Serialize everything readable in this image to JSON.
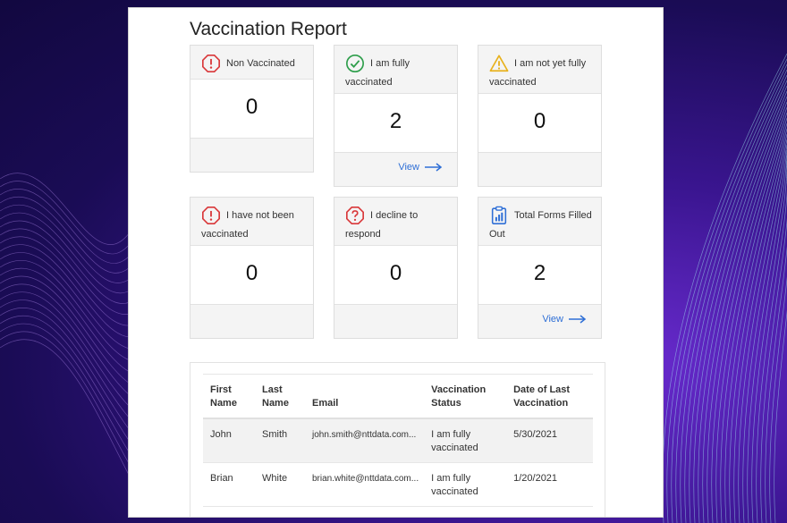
{
  "page": {
    "title": "Vaccination Report"
  },
  "cards": [
    {
      "label": "Non Vaccinated",
      "value": "0",
      "icon": "alert-octagon-icon",
      "link": ""
    },
    {
      "label": "I am fully vaccinated",
      "value": "2",
      "icon": "check-circle-icon",
      "link": "View"
    },
    {
      "label": "I am not yet fully vaccinated",
      "value": "0",
      "icon": "warning-triangle-icon",
      "link": ""
    },
    {
      "label": "I have not been vaccinated",
      "value": "0",
      "icon": "alert-octagon-icon",
      "link": ""
    },
    {
      "label": "I decline to respond",
      "value": "0",
      "icon": "question-octagon-icon",
      "link": ""
    },
    {
      "label": "Total Forms Filled Out",
      "value": "2",
      "icon": "clipboard-chart-icon",
      "link": "View"
    }
  ],
  "table": {
    "headers": [
      "First Name",
      "Last Name",
      "Email",
      "Vaccination Status",
      "Date of Last Vaccination"
    ],
    "rows": [
      [
        "John",
        "Smith",
        "john.smith@nttdata.com...",
        "I am fully vaccinated",
        "5/30/2021"
      ],
      [
        "Brian",
        "White",
        "brian.white@nttdata.com...",
        "I am fully vaccinated",
        "1/20/2021"
      ]
    ]
  },
  "colors": {
    "link": "#2f6fd6",
    "danger": "#d9383a",
    "success": "#2e9e4b",
    "warning": "#e8b11c",
    "info": "#2f6fd6"
  }
}
